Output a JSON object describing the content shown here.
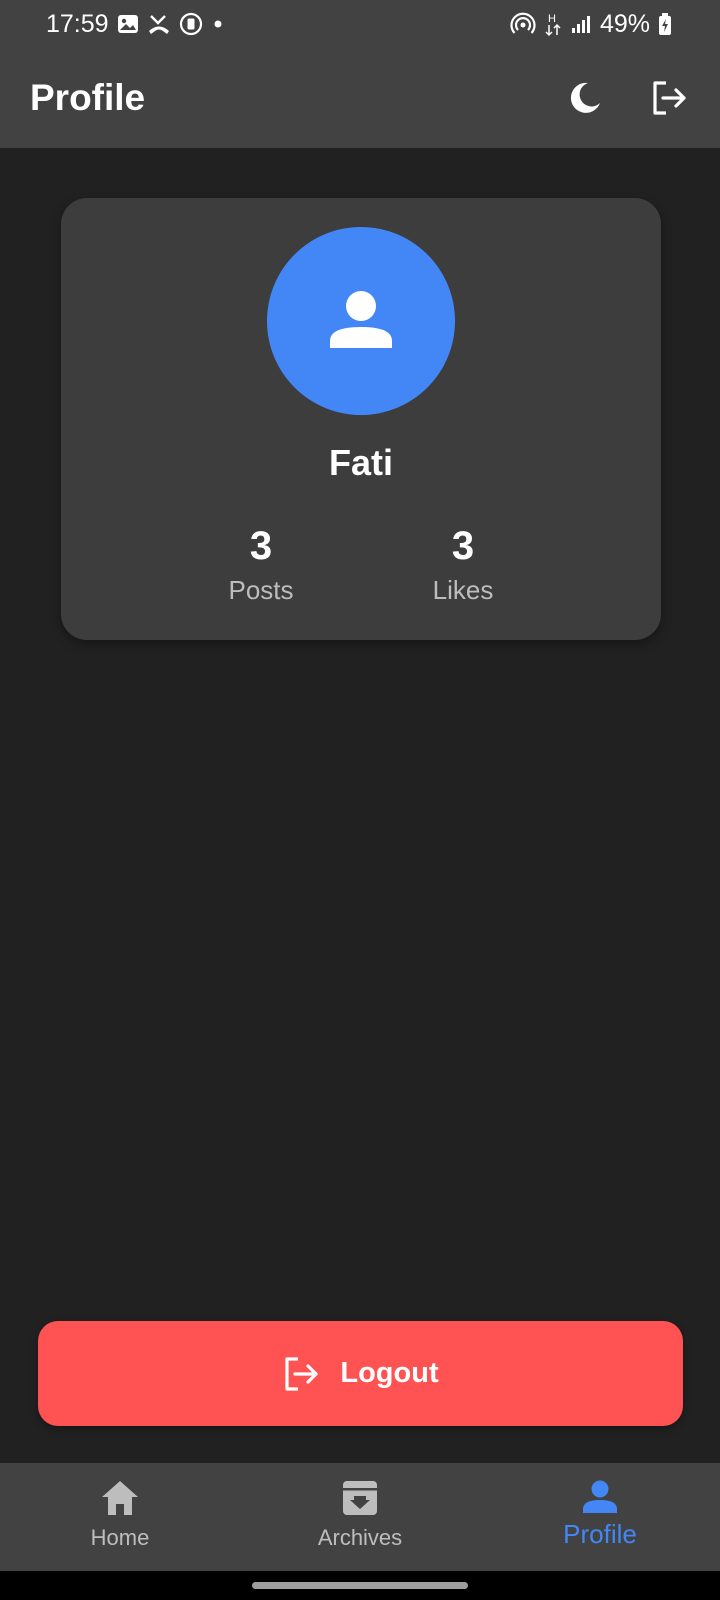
{
  "status_bar": {
    "time": "17:59",
    "left_icons": [
      "gallery-icon",
      "missed-call-icon",
      "screen-record-icon",
      "dot-icon"
    ],
    "right_icons": [
      "hotspot-icon",
      "network-h-icon",
      "signal-icon"
    ],
    "battery_percent": "49%"
  },
  "app_bar": {
    "title": "Profile",
    "actions": [
      "moon-icon",
      "logout-icon"
    ]
  },
  "profile": {
    "name": "Fati",
    "posts_value": "3",
    "posts_label": "Posts",
    "likes_value": "3",
    "likes_label": "Likes"
  },
  "logout_button": {
    "label": "Logout"
  },
  "bottom_nav": {
    "items": [
      {
        "label": "Home",
        "icon": "home-icon",
        "active": false
      },
      {
        "label": "Archives",
        "icon": "archive-icon",
        "active": false
      },
      {
        "label": "Profile",
        "icon": "person-icon",
        "active": true
      }
    ]
  },
  "colors": {
    "background": "#212121",
    "bar": "#424242",
    "card": "#3d3d3d",
    "accent": "#4287f5",
    "danger": "#ff5252"
  }
}
